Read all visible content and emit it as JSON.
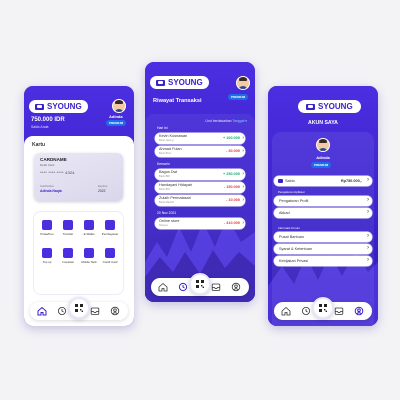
{
  "brand": {
    "logo_text": "SYOUNG"
  },
  "colors": {
    "primary": "#3a22c9",
    "accent_blue": "#1e6de8",
    "positive": "#18a86b",
    "negative": "#e03a3a"
  },
  "home": {
    "balance": "750.000 IDR",
    "balance_label": "Saldo Anda",
    "user_name": "Adinda",
    "badge": "PREMIUM",
    "card_section_title": "Kartu",
    "card": {
      "bank": "CARDNAME",
      "type": "Debit Card",
      "number": "**** **** **** 4324",
      "holder_label": "Cardholder",
      "holder": "Adinda Naqia",
      "expiry_label": "Expires",
      "expiry": "2022",
      "brand": "VISA"
    },
    "menu": [
      {
        "label": "Pulsa/Kuo",
        "icon": "phone-icon"
      },
      {
        "label": "Transfer",
        "icon": "send-icon"
      },
      {
        "label": "E-Wallet",
        "icon": "wallet-icon"
      },
      {
        "label": "Pembayaran",
        "icon": "receipt-icon"
      },
      {
        "label": "Top up",
        "icon": "plus-icon"
      },
      {
        "label": "Investasi",
        "icon": "chart-icon"
      },
      {
        "label": "Mobile Tarik",
        "icon": "mobile-icon"
      },
      {
        "label": "Credit Card",
        "icon": "card-icon"
      }
    ]
  },
  "history": {
    "title": "Riwayat Transaksi",
    "badge": "PREMIUM",
    "sort_label": "Urut berdasarkan",
    "sort_value": "Tanggal",
    "groups": [
      {
        "label": "Hari ini",
        "items": [
          {
            "name": "Kevin Kusnawan",
            "date": "Bank Jateng",
            "amount": "+ 100.000",
            "sign": "plus"
          },
          {
            "name": "Ahmad Fulan",
            "date": "Bank BCA",
            "amount": "- 30.000",
            "sign": "minus"
          }
        ]
      },
      {
        "label": "Kemarin",
        "items": [
          {
            "name": "Bagus Dwi",
            "date": "Bank BRI",
            "amount": "+ 250.000",
            "sign": "plus"
          },
          {
            "name": "Handayani Hidayah",
            "date": "Bank BNI",
            "amount": "- 150.000",
            "sign": "minus"
          },
          {
            "name": "Zulaih Permatasari",
            "date": "Bank Mandiri",
            "amount": "- 10.000",
            "sign": "minus"
          }
        ]
      },
      {
        "label": "20 Nov 2021",
        "items": [
          {
            "name": "Online store",
            "date": "Shopee",
            "amount": "- 410.000",
            "sign": "minus"
          }
        ]
      }
    ]
  },
  "account": {
    "title": "AKUN SAYA",
    "user_name": "Adinda",
    "badge": "PREMIUM",
    "balance_label": "Saldo",
    "balance_value": "Rp750.000,-",
    "settings_label": "Pengaturan Aplikasi",
    "settings_items": [
      "Pengaturan Profil",
      "Akkad"
    ],
    "info_label": "Informasi Umum",
    "info_items": [
      "Pusat Bantuan",
      "Syarat & Ketentuan",
      "Kebijakan Privasi"
    ]
  }
}
